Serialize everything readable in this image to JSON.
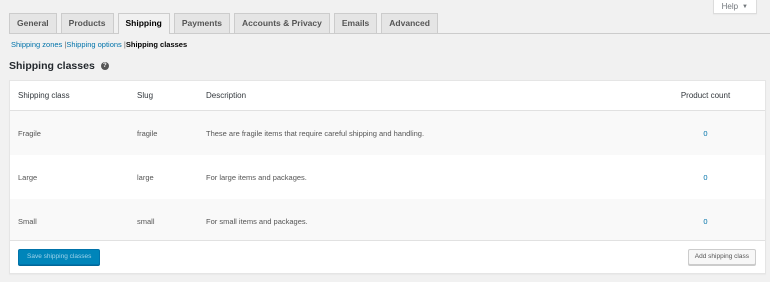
{
  "help": {
    "label": "Help",
    "caret": "▼"
  },
  "tabs": [
    {
      "label": "General"
    },
    {
      "label": "Products"
    },
    {
      "label": "Shipping"
    },
    {
      "label": "Payments"
    },
    {
      "label": "Accounts & Privacy"
    },
    {
      "label": "Emails"
    },
    {
      "label": "Advanced"
    }
  ],
  "subnav": {
    "zones": "Shipping zones",
    "sep1": "|",
    "options": "Shipping options",
    "sep2": "|",
    "classes": "Shipping classes"
  },
  "section": {
    "title": "Shipping classes",
    "help_glyph": "?"
  },
  "table": {
    "headers": {
      "class": "Shipping class",
      "slug": "Slug",
      "description": "Description",
      "count": "Product count"
    },
    "rows": [
      {
        "class": "Fragile",
        "slug": "fragile",
        "description": "These are fragile items that require careful shipping and handling.",
        "count": "0"
      },
      {
        "class": "Large",
        "slug": "large",
        "description": "For large items and packages.",
        "count": "0"
      },
      {
        "class": "Small",
        "slug": "small",
        "description": "For small items and packages.",
        "count": "0"
      }
    ]
  },
  "footer": {
    "save_label": "Save shipping classes",
    "add_label": "Add shipping class"
  },
  "colors": {
    "accent": "#0073aa",
    "primary_button": "#0085ba",
    "background": "#f1f1f1"
  }
}
